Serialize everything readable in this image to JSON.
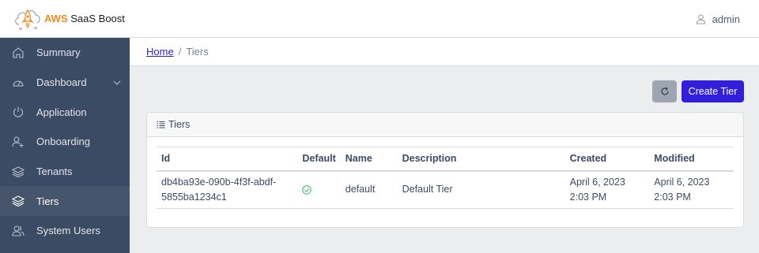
{
  "header": {
    "brand_aws": "AWS",
    "brand_rest": " SaaS Boost",
    "user": "admin"
  },
  "sidebar": {
    "items": [
      {
        "label": "Summary",
        "icon": "home-icon"
      },
      {
        "label": "Dashboard",
        "icon": "speedometer-icon"
      },
      {
        "label": "Application",
        "icon": "power-icon"
      },
      {
        "label": "Onboarding",
        "icon": "user-plus-icon"
      },
      {
        "label": "Tenants",
        "icon": "layers-icon"
      },
      {
        "label": "Tiers",
        "icon": "layers-icon"
      },
      {
        "label": "System Users",
        "icon": "people-icon"
      }
    ],
    "active": "Tiers"
  },
  "breadcrumb": {
    "home": "Home",
    "separator": "/",
    "current": "Tiers"
  },
  "toolbar": {
    "refresh_icon": "refresh-icon",
    "create_label": "Create Tier"
  },
  "card": {
    "title": "Tiers"
  },
  "table": {
    "columns": [
      "Id",
      "Default",
      "Name",
      "Description",
      "Created",
      "Modified"
    ],
    "rows": [
      {
        "id_line1": "db4ba93e-090b-4f3f-abdf-",
        "id_line2": "5855ba1234c1",
        "default": true,
        "name": "default",
        "description": "Default Tier",
        "created_line1": "April 6, 2023",
        "created_line2": "2:03 PM",
        "modified_line1": "April 6, 2023",
        "modified_line2": "2:03 PM"
      }
    ]
  },
  "colors": {
    "sidebar": "#3c4b64",
    "primary": "#321fdb",
    "brand_orange": "#f08a1e",
    "success": "#2eb85c"
  }
}
